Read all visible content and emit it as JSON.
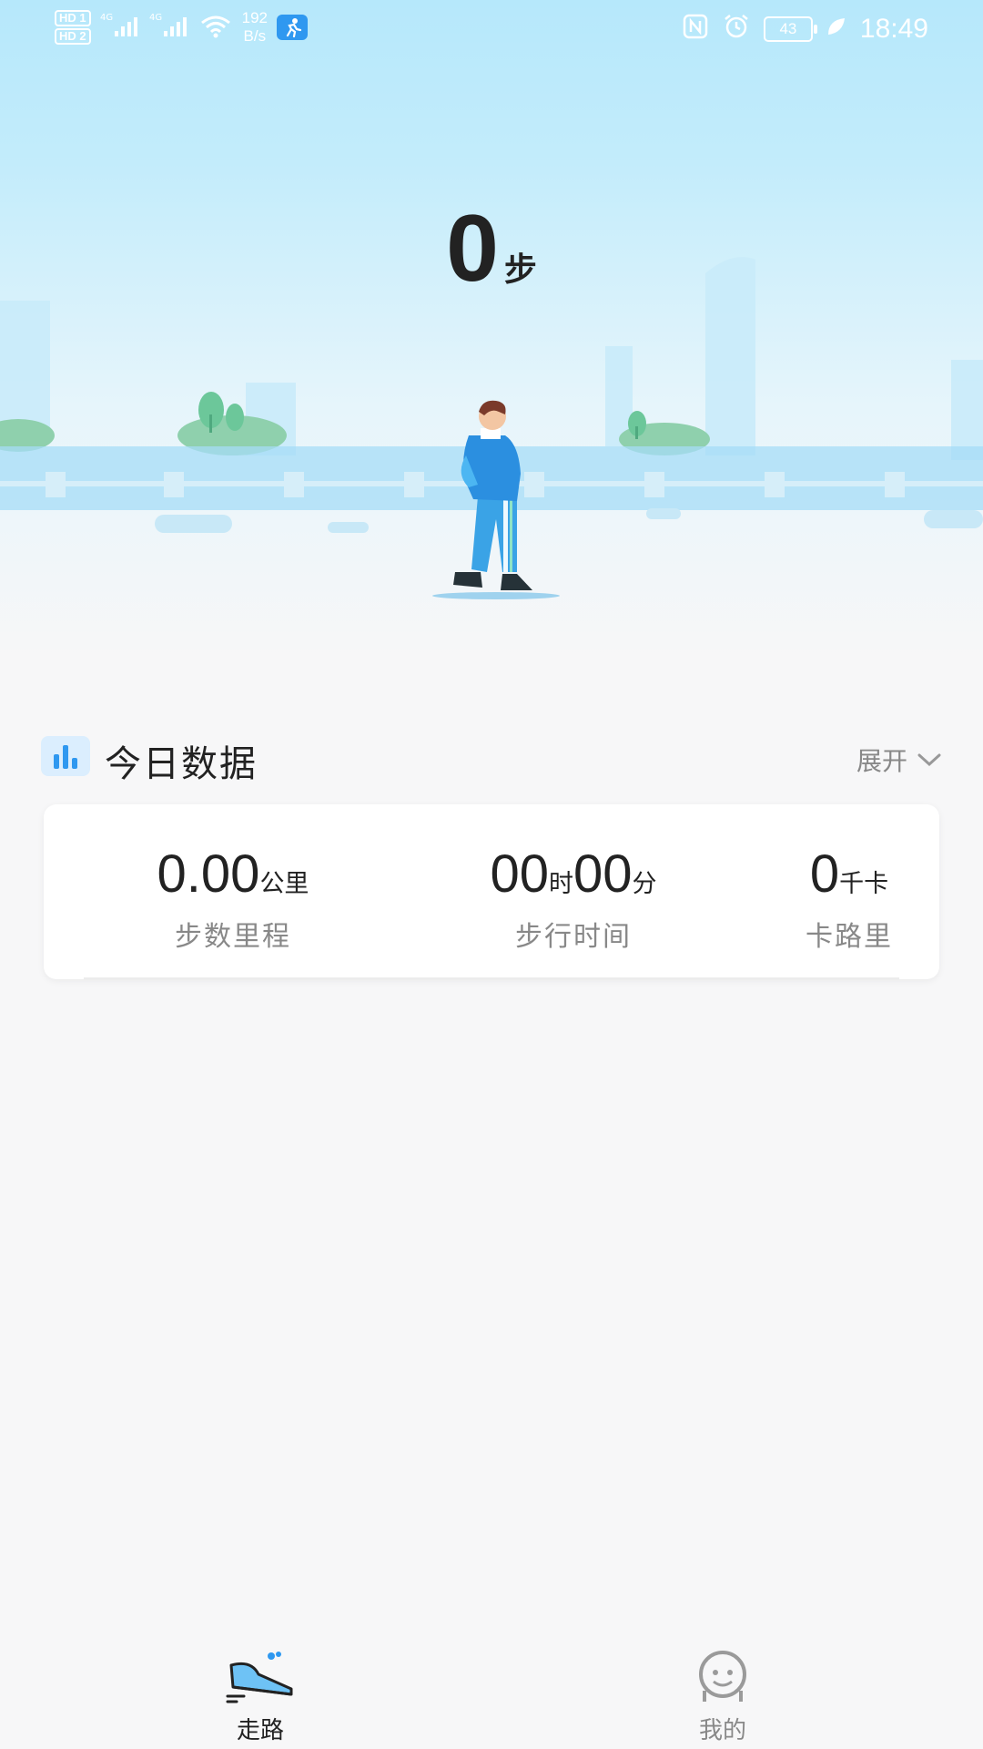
{
  "status_bar": {
    "sim_labels": [
      "HD 1",
      "HD 2"
    ],
    "network_labels": [
      "4G",
      "4G"
    ],
    "speed_value": "192",
    "speed_unit": "B/s",
    "battery": "43",
    "time": "18:49"
  },
  "steps": {
    "count": "0",
    "unit": "步"
  },
  "today": {
    "title": "今日数据",
    "expand_label": "展开",
    "stats": [
      {
        "value": "0.00",
        "unit": "公里",
        "label": "步数里程"
      },
      {
        "hours": "00",
        "hours_unit": "时",
        "minutes": "00",
        "minutes_unit": "分",
        "label": "步行时间"
      },
      {
        "value": "0",
        "unit": "千卡",
        "label": "卡路里"
      }
    ]
  },
  "tabs": [
    {
      "label": "走路",
      "icon": "shoe-icon",
      "active": true
    },
    {
      "label": "我的",
      "icon": "smile-face-icon",
      "active": false
    }
  ],
  "colors": {
    "accent": "#2f98f0",
    "text": "#222222",
    "muted": "#888888",
    "bg": "#f7f7f8"
  }
}
